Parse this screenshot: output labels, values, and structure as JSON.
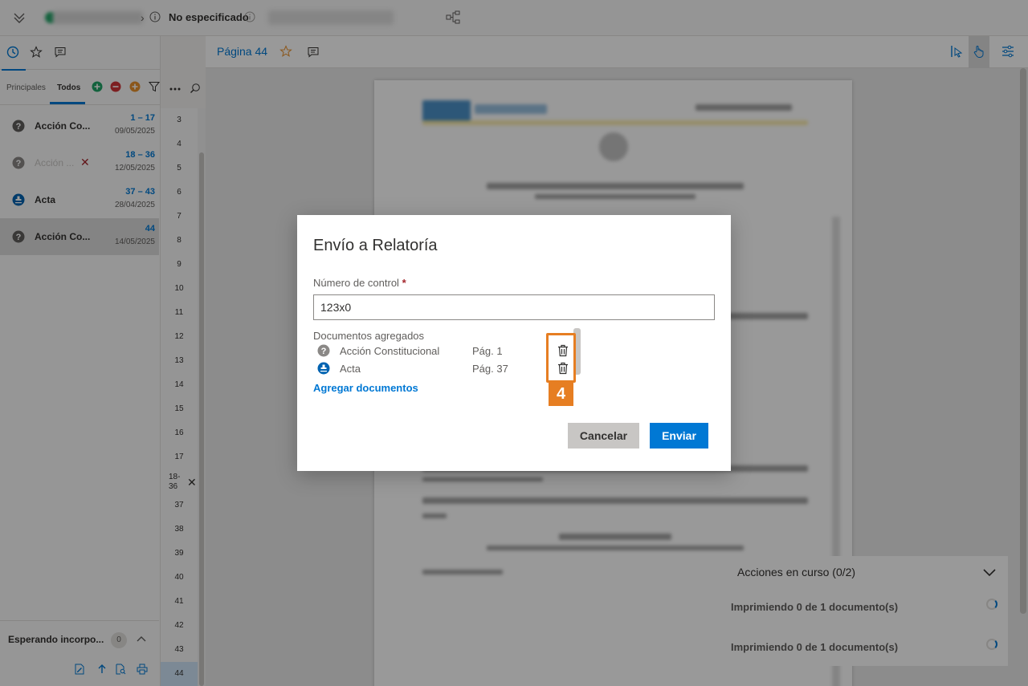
{
  "topbar": {
    "status": "No especificado"
  },
  "left_panel": {
    "tabs": [
      "Principales",
      "Todos"
    ],
    "active_tab": "Todos",
    "documents": [
      {
        "name": "Acción Co...",
        "range": "1 – 17",
        "date": "09/05/2025",
        "icon": "question-icon",
        "faded": false,
        "removed": false
      },
      {
        "name": "Acción ...",
        "range": "18 – 36",
        "date": "12/05/2025",
        "icon": "question-icon",
        "faded": true,
        "removed": true
      },
      {
        "name": "Acta",
        "range": "37 – 43",
        "date": "28/04/2025",
        "icon": "stamp-icon",
        "faded": false,
        "removed": false
      },
      {
        "name": "Acción Co...",
        "range": "44",
        "date": "14/05/2025",
        "icon": "question-icon",
        "faded": false,
        "removed": false
      }
    ],
    "waiting": {
      "label": "Esperando incorpo...",
      "count": "0"
    }
  },
  "page_numbers": [
    "3",
    "4",
    "5",
    "6",
    "7",
    "8",
    "9",
    "10",
    "11",
    "12",
    "13",
    "14",
    "15",
    "16",
    "17",
    "18-\n36",
    "37",
    "38",
    "39",
    "40",
    "41",
    "42",
    "43",
    "44"
  ],
  "viewer": {
    "page_title": "Página 44"
  },
  "dialog": {
    "title": "Envío a Relatoría",
    "field_label": "Número de control",
    "required_mark": "*",
    "control_number": "123x0",
    "added_label": "Documentos agregados",
    "documents": [
      {
        "name": "Acción Constitucional",
        "page": "Pág. 1",
        "icon": "question-icon"
      },
      {
        "name": "Acta",
        "page": "Pág. 37",
        "icon": "stamp-icon"
      }
    ],
    "add_link": "Agregar documentos",
    "cancel_label": "Cancelar",
    "send_label": "Enviar"
  },
  "actions": {
    "header": "Acciones en curso (0/2)",
    "rows": [
      "Imprimiendo 0 de 1 documento(s)",
      "Imprimiendo 0 de 1 documento(s)"
    ]
  },
  "callout": {
    "number": "4"
  },
  "colors": {
    "accent": "#0078d4",
    "callout": "#e67e22",
    "danger": "#a4262c"
  }
}
